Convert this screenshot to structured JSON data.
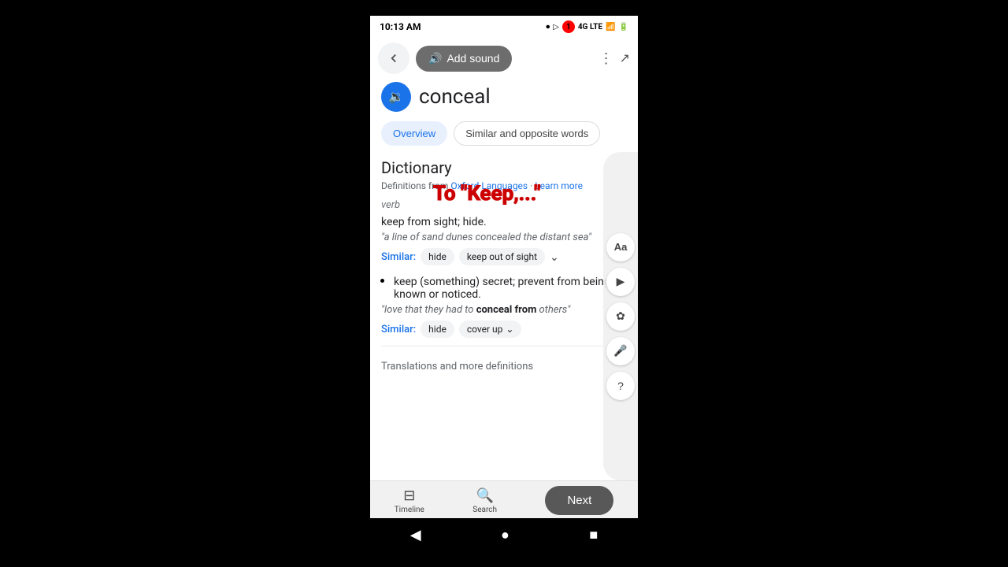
{
  "statusBar": {
    "time": "10:13 AM",
    "notification": "1",
    "network": "4G LTE"
  },
  "header": {
    "addSoundLabel": "Add sound",
    "wordTitle": "conceal"
  },
  "tabs": [
    {
      "label": "Overview",
      "active": true
    },
    {
      "label": "Similar and opposite words",
      "active": false
    }
  ],
  "dictionary": {
    "title": "Dictionary",
    "sourcePre": "Definitions from ",
    "sourceLink": "Oxford Languages",
    "learnMore": "Learn more",
    "pos": "verb",
    "annotation": "To \"Keep,...\"",
    "definitions": [
      {
        "text": "keep from sight; hide.",
        "example": "\"a line of sand dunes concealed the distant sea\"",
        "similarLabel": "Similar:",
        "similar": [
          "hide",
          "keep out of sight"
        ],
        "hasDropdown": true
      },
      {
        "text": "keep (something) secret; prevent from being known or noticed.",
        "exampleBold": "conceal from",
        "examplePre": "\"love that they had to ",
        "examplePost": " others\"",
        "similarLabel": "Similar:",
        "similar": [
          "hide",
          "cover up"
        ],
        "hasDropdown": true
      }
    ],
    "translationsLabel": "Translations and more definitions"
  },
  "bottomNav": {
    "timelineLabel": "Timeline",
    "searchLabel": "Search",
    "nextLabel": "Next"
  },
  "sidebarTools": [
    "Aa",
    "▶",
    "✿",
    "🎤",
    "?"
  ]
}
